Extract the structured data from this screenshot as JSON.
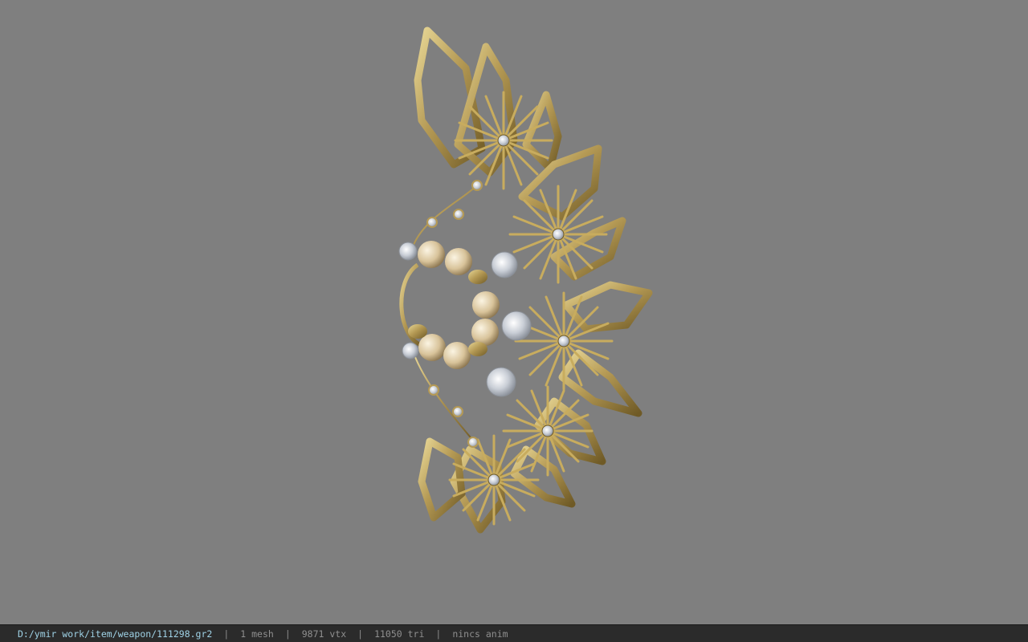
{
  "viewer": {
    "background_color": "#7f7f7f",
    "model_name": "111298.gr2"
  },
  "statusbar": {
    "file_path": "D:/ymir work/item/weapon/111298.gr2",
    "mesh_count": "1 mesh",
    "vertex_count": "9871 vtx",
    "triangle_count": "11050 tri",
    "animation": "nincs anim",
    "separator": "|",
    "path_color": "#9fd2e6",
    "text_color": "#8f8f8f"
  },
  "model_colors": {
    "gold": "#b59a55",
    "gold_dark": "#6f5a26",
    "gold_light": "#e8d796",
    "pearl": "#e6d6b0",
    "gem": "#dfe3e8"
  }
}
